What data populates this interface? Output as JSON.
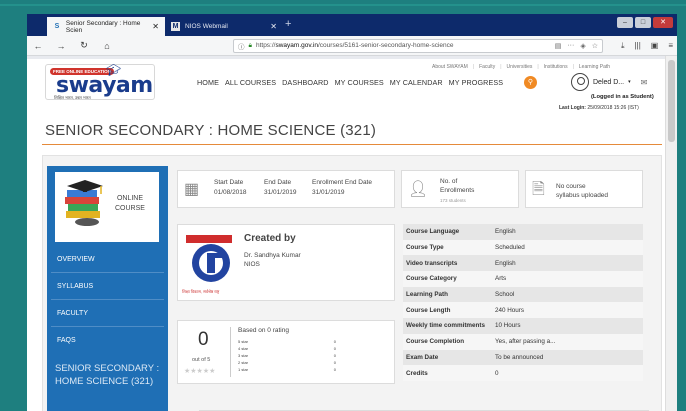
{
  "browser": {
    "tabs": [
      {
        "label": "Senior Secondary : Home Scien",
        "favicon": "S"
      },
      {
        "label": "NIOS Webmail",
        "favicon": "M"
      }
    ],
    "url_prefix": "https://",
    "url_host": "swayam.gov.in",
    "url_path": "/courses/5161-senior-secondary-home-science",
    "more_dots": "···"
  },
  "header": {
    "logo_pill": "FREE ONLINE EDUCATION",
    "logo_word": "swayam",
    "logo_tag": "शिक्षित भारत, उन्नत भारत",
    "utility_links": [
      "About SWAYAM",
      "Faculty",
      "Universities",
      "Institutions",
      "Learning Path"
    ],
    "nav": [
      "HOME",
      "ALL COURSES",
      "DASHBOARD",
      "MY COURSES",
      "MY CALENDAR",
      "MY PROGRESS"
    ],
    "user_name": "Deled D...",
    "logged_as": "(Logged in as Student)",
    "last_login_label": "Last Login:",
    "last_login_value": "25/09/2018 15:26 (IST)"
  },
  "course": {
    "title": "SENIOR SECONDARY : HOME SCIENCE (321)",
    "sidebar_image_label": [
      "ONLINE",
      "COURSE"
    ],
    "sidebar_menu": [
      "OVERVIEW",
      "SYLLABUS",
      "FACULTY",
      "FAQS"
    ],
    "sidebar_course": [
      "SENIOR SECONDARY :",
      "HOME SCIENCE (321)"
    ],
    "dates": [
      {
        "label": "Start Date",
        "value": "01/08/2018"
      },
      {
        "label": "End Date",
        "value": "31/01/2019"
      },
      {
        "label": "Enrollment End Date",
        "value": "31/01/2019"
      }
    ],
    "enrollments_label": [
      "No. of",
      "Enrollments"
    ],
    "enrollments_value": "173 students",
    "syllabus_label": [
      "No course",
      "syllabus uploaded"
    ],
    "created_by": "Created by",
    "creator_name": "Dr. Sandhya Kumar",
    "creator_org": "NIOS",
    "creator_logo_caption": "शिक्षा विकास, सर्वश्रेष्ठ राष्ट्र",
    "rating_value": "0",
    "rating_out_of": "out of 5",
    "rating_based": "Based on 0 rating",
    "rating_rows": [
      {
        "label": "5 star",
        "count": "0"
      },
      {
        "label": "4 star",
        "count": "0"
      },
      {
        "label": "3 star",
        "count": "0"
      },
      {
        "label": "2 star",
        "count": "0"
      },
      {
        "label": "1 star",
        "count": "0"
      }
    ],
    "info": [
      {
        "key": "Course Language",
        "value": "English"
      },
      {
        "key": "Course Type",
        "value": "Scheduled"
      },
      {
        "key": "Video transcripts",
        "value": "English"
      },
      {
        "key": "Course Category",
        "value": "Arts"
      },
      {
        "key": "Learning Path",
        "value": "School"
      },
      {
        "key": "Course Length",
        "value": "240 Hours"
      },
      {
        "key": "Weekly time commitments",
        "value": "10 Hours"
      },
      {
        "key": "Course Completion",
        "value": "Yes, after passing a..."
      },
      {
        "key": "Exam Date",
        "value": "To be announced"
      },
      {
        "key": "Credits",
        "value": "0"
      }
    ]
  },
  "colors": {
    "accent": "#1f6fb5",
    "orange": "#f08a24",
    "tabbar": "#0d2a6b"
  }
}
